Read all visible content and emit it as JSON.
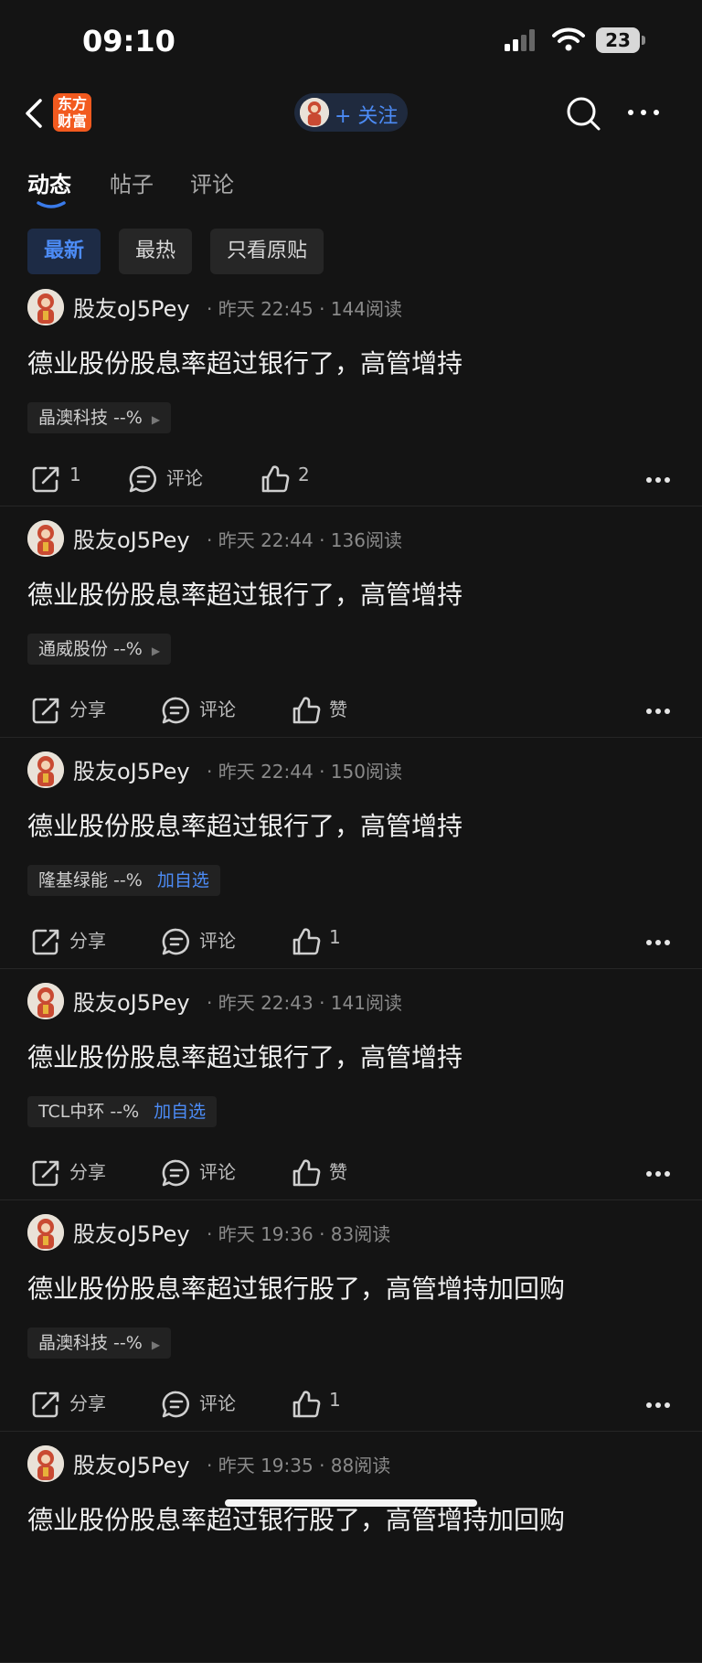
{
  "status_bar": {
    "time": "09:10",
    "battery": "23"
  },
  "nav": {
    "logo_line1": "东方",
    "logo_line2": "财富",
    "follow_label": "+ 关注"
  },
  "tabs": [
    "动态",
    "帖子",
    "评论"
  ],
  "filters": [
    "最新",
    "最热",
    "只看原贴"
  ],
  "posts": [
    {
      "author": "股友oJ5Pey",
      "meta": "· 昨天 22:45 · 144阅读",
      "title": "德业股份股息率超过银行了，高管增持",
      "stock": "晶澳科技 --%",
      "share": "1",
      "comment": "评论",
      "like": "2"
    },
    {
      "author": "股友oJ5Pey",
      "meta": "· 昨天 22:44 · 136阅读",
      "title": "德业股份股息率超过银行了，高管增持",
      "stock": "通威股份 --%",
      "share": "分享",
      "comment": "评论",
      "like": "赞"
    },
    {
      "author": "股友oJ5Pey",
      "meta": "· 昨天 22:44 · 150阅读",
      "title": "德业股份股息率超过银行了，高管增持",
      "stock": "隆基绿能 --%",
      "add_watch": "加自选",
      "share": "分享",
      "comment": "评论",
      "like": "1"
    },
    {
      "author": "股友oJ5Pey",
      "meta": "· 昨天 22:43 · 141阅读",
      "title": "德业股份股息率超过银行了，高管增持",
      "stock": "TCL中环 --%",
      "add_watch": "加自选",
      "share": "分享",
      "comment": "评论",
      "like": "赞"
    },
    {
      "author": "股友oJ5Pey",
      "meta": "· 昨天 19:36 · 83阅读",
      "title": "德业股份股息率超过银行股了，高管增持加回购",
      "stock": "晶澳科技 --%",
      "share": "分享",
      "comment": "评论",
      "like": "1"
    },
    {
      "author": "股友oJ5Pey",
      "meta": "· 昨天 19:35 · 88阅读",
      "title": "德业股份股息率超过银行股了，高管增持加回购"
    }
  ]
}
